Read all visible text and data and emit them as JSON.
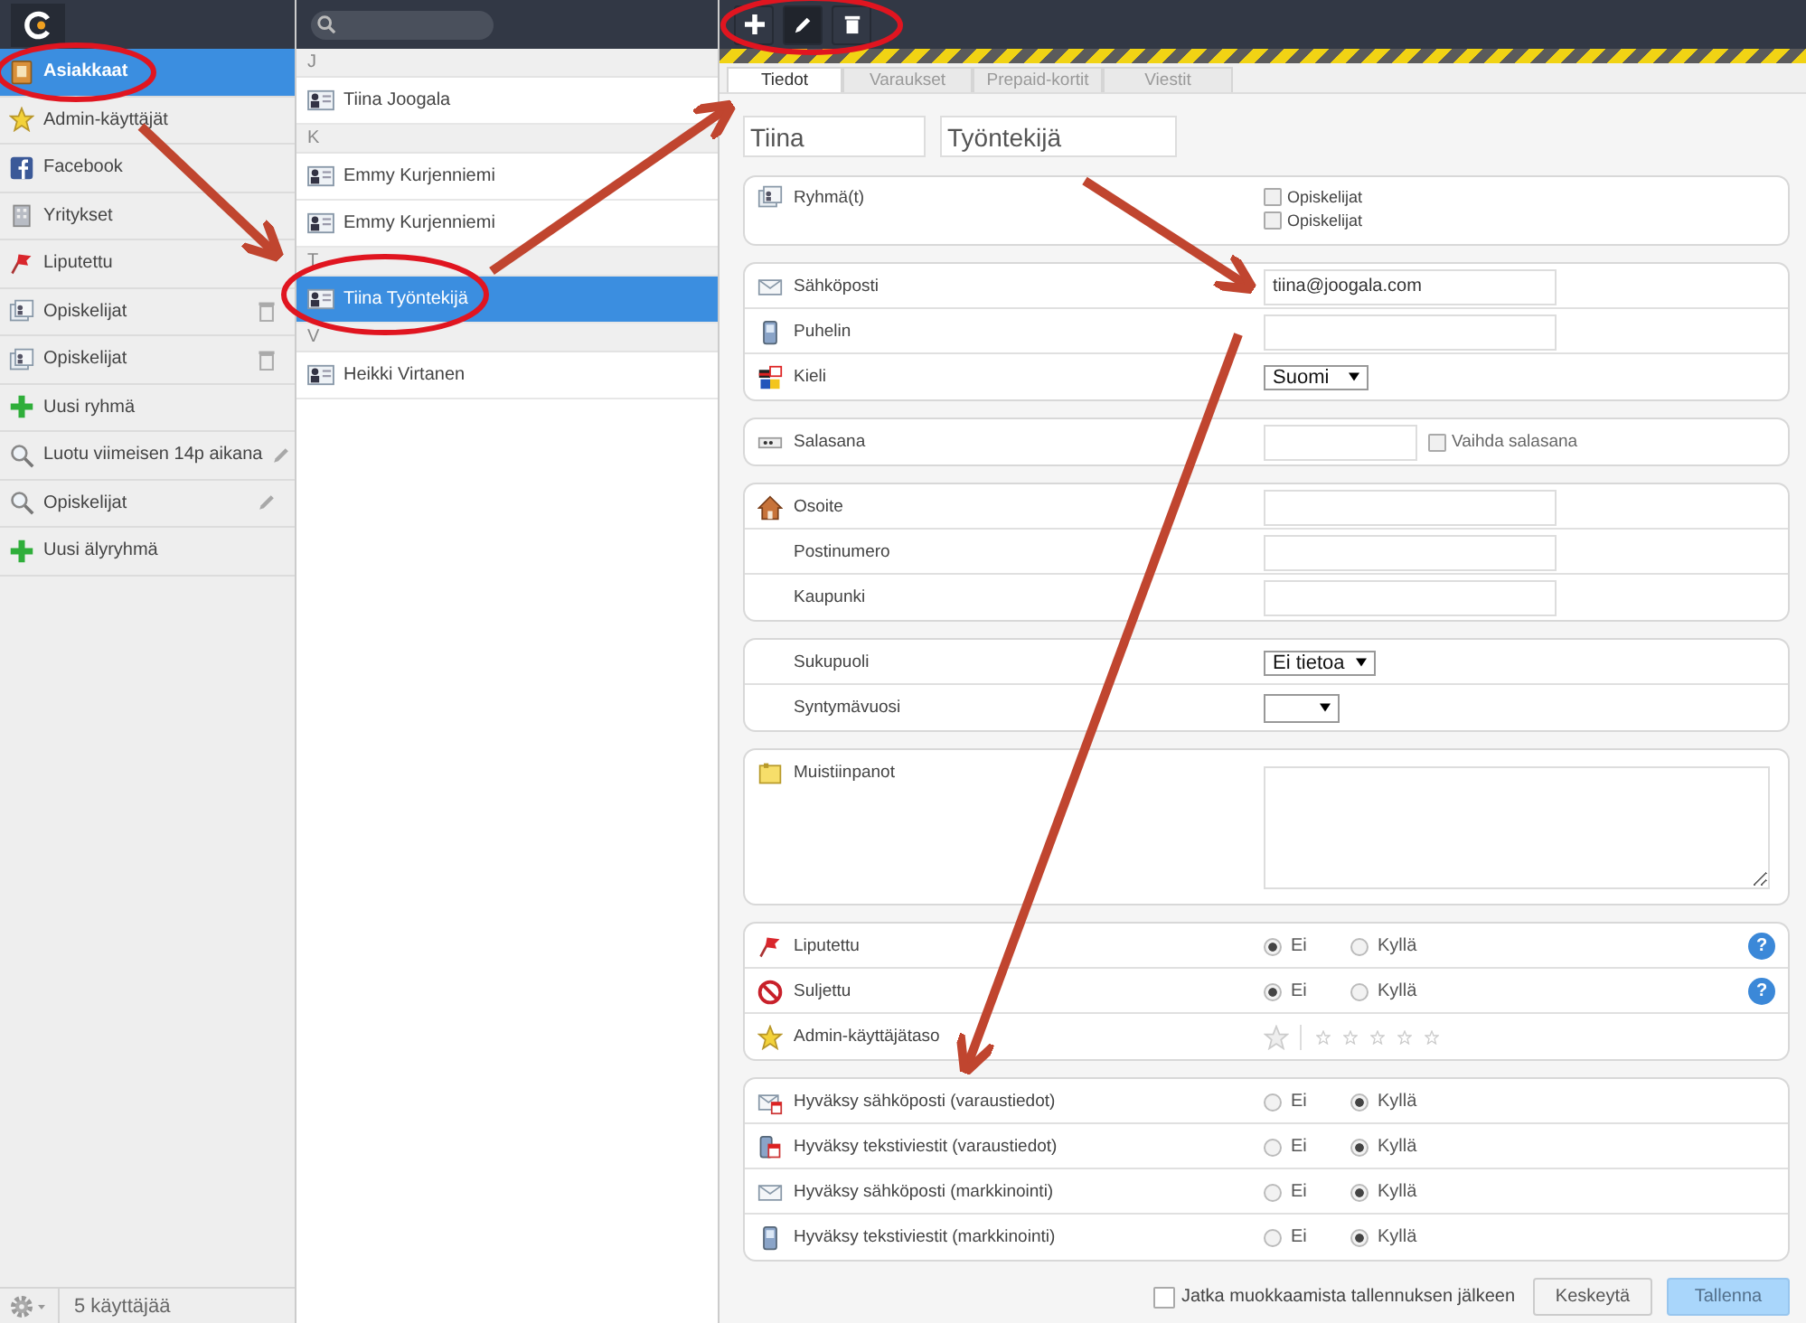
{
  "sidebar": {
    "items": [
      {
        "label": "Asiakkaat",
        "selected": true
      },
      {
        "label": "Admin-käyttäjät",
        "selected": false
      },
      {
        "label": "Facebook",
        "selected": false
      },
      {
        "label": "Yritykset",
        "selected": false
      },
      {
        "label": "Liputettu",
        "selected": false
      },
      {
        "label": "Opiskelijat",
        "selected": false
      },
      {
        "label": "Opiskelijat",
        "selected": false
      },
      {
        "label": "Uusi ryhmä",
        "selected": false
      },
      {
        "label": "Luotu viimeisen 14p aikana",
        "selected": false
      },
      {
        "label": "Opiskelijat",
        "selected": false
      },
      {
        "label": "Uusi älyryhmä",
        "selected": false
      }
    ],
    "user_count": "5 käyttäjää"
  },
  "contacts": {
    "groups": [
      {
        "letter": "J",
        "items": [
          {
            "name": "Tiina Joogala",
            "selected": false
          }
        ]
      },
      {
        "letter": "K",
        "items": [
          {
            "name": "Emmy Kurjenniemi",
            "selected": false
          },
          {
            "name": "Emmy Kurjenniemi",
            "selected": false
          }
        ]
      },
      {
        "letter": "T",
        "items": [
          {
            "name": "Tiina Työntekijä",
            "selected": true
          }
        ]
      },
      {
        "letter": "V",
        "items": [
          {
            "name": "Heikki Virtanen",
            "selected": false
          }
        ]
      }
    ]
  },
  "tabs": [
    {
      "label": "Tiedot",
      "selected": true
    },
    {
      "label": "Varaukset",
      "selected": false
    },
    {
      "label": "Prepaid-kortit",
      "selected": false
    },
    {
      "label": "Viestit",
      "selected": false
    }
  ],
  "name": {
    "first": "Tiina",
    "last": "Työntekijä"
  },
  "sections": [
    {
      "rows": [
        {
          "kind": "checkboxes",
          "label": "Ryhmä(t)",
          "options": [
            {
              "label": "Opiskelijat",
              "checked": false
            },
            {
              "label": "Opiskelijat",
              "checked": false
            }
          ]
        }
      ]
    },
    {
      "rows": [
        {
          "kind": "text",
          "label": "Sähköposti",
          "value": "tiina@joogala.com"
        },
        {
          "kind": "text",
          "label": "Puhelin"
        },
        {
          "kind": "select",
          "label": "Kieli",
          "value": "Suomi"
        }
      ]
    },
    {
      "rows": [
        {
          "kind": "password",
          "label": "Salasana",
          "option": {
            "label": "Vaihda salasana",
            "checked": false
          }
        }
      ]
    },
    {
      "rows": [
        {
          "kind": "text",
          "label": "Osoite"
        },
        {
          "kind": "text",
          "label": "Postinumero"
        },
        {
          "kind": "text",
          "label": "Kaupunki"
        }
      ]
    },
    {
      "rows": [
        {
          "kind": "select",
          "label": "Sukupuoli",
          "value": "Ei tietoa"
        },
        {
          "kind": "select",
          "label": "Syntymävuosi"
        }
      ]
    },
    {
      "rows": [
        {
          "kind": "textarea",
          "label": "Muistiinpanot"
        }
      ]
    },
    {
      "rows": [
        {
          "kind": "radio",
          "label": "Liputettu",
          "help": "?",
          "options": [
            {
              "label": "Ei",
              "selected": true
            },
            {
              "label": "Kyllä",
              "selected": false
            }
          ]
        },
        {
          "kind": "radio",
          "label": "Suljettu",
          "help": "?",
          "options": [
            {
              "label": "Ei",
              "selected": true
            },
            {
              "label": "Kyllä",
              "selected": false
            }
          ]
        },
        {
          "kind": "stars",
          "label": "Admin-käyttäjätaso",
          "stars": 0
        }
      ]
    },
    {
      "rows": [
        {
          "kind": "radio",
          "label": "Hyväksy sähköposti (varaustiedot)",
          "options": [
            {
              "label": "Ei",
              "selected": false
            },
            {
              "label": "Kyllä",
              "selected": true
            }
          ]
        },
        {
          "kind": "radio",
          "label": "Hyväksy tekstiviestit (varaustiedot)",
          "options": [
            {
              "label": "Ei",
              "selected": false
            },
            {
              "label": "Kyllä",
              "selected": true
            }
          ]
        },
        {
          "kind": "radio",
          "label": "Hyväksy sähköposti (markkinointi)",
          "options": [
            {
              "label": "Ei",
              "selected": false
            },
            {
              "label": "Kyllä",
              "selected": true
            }
          ]
        },
        {
          "kind": "radio",
          "label": "Hyväksy tekstiviestit (markkinointi)",
          "options": [
            {
              "label": "Ei",
              "selected": false
            },
            {
              "label": "Kyllä",
              "selected": true
            }
          ]
        }
      ]
    }
  ],
  "footer": {
    "continue_editing": {
      "label": "Jatka muokkaamista tallennuksen jälkeen",
      "checked": false
    },
    "buttons": [
      {
        "label": "Keskeytä",
        "kind": "secondary"
      },
      {
        "label": "Tallenna",
        "kind": "primary"
      }
    ]
  }
}
